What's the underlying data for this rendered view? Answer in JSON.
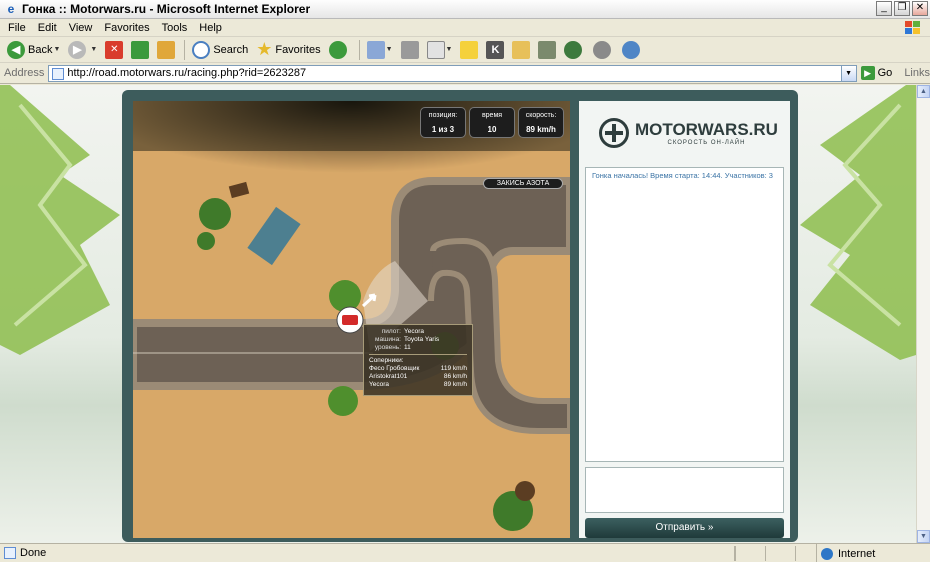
{
  "window": {
    "title": "Гонка :: Motorwars.ru - Microsoft Internet Explorer"
  },
  "menu": [
    "File",
    "Edit",
    "View",
    "Favorites",
    "Tools",
    "Help"
  ],
  "toolbar": {
    "back": "Back",
    "search": "Search",
    "favorites": "Favorites"
  },
  "address": {
    "label": "Address",
    "url": "http://road.motorwars.ru/racing.php?rid=2623287",
    "go": "Go",
    "links": "Links"
  },
  "hud": {
    "position_label": "позиция:",
    "position_value": "1 из 3",
    "time_label": "время",
    "time_value": "10",
    "speed_label": "скорость:",
    "speed_value": "89 km/h"
  },
  "nitro_label": "ЗАКИСЬ АЗОТА",
  "tooltip": {
    "pilot_label": "пилот:",
    "pilot": "Yecora",
    "car_label": "машина:",
    "car": "Toyota Yaris",
    "level_label": "уровень:",
    "level": "11",
    "rivals_label": "Соперники:",
    "rivals": [
      {
        "name": "Фесо Гробовщик",
        "speed": "119 km/h"
      },
      {
        "name": "Aristokrat101",
        "speed": "86 km/h"
      },
      {
        "name": "Yecora",
        "speed": "89 km/h"
      }
    ]
  },
  "logo": {
    "name": "MOTORWARS.RU",
    "tagline": "СКОРОСТЬ ОН-ЛАЙН"
  },
  "chat": {
    "message": "Гонка началась! Время старта: 14:44. Участников: 3",
    "send": "Отправить »"
  },
  "status": {
    "text": "Done",
    "zone": "Internet"
  },
  "colors": {
    "panel": "#3d5c5c",
    "sand": "#d9a96a",
    "road": "#6b5f53",
    "chat_text": "#3a73a5"
  }
}
